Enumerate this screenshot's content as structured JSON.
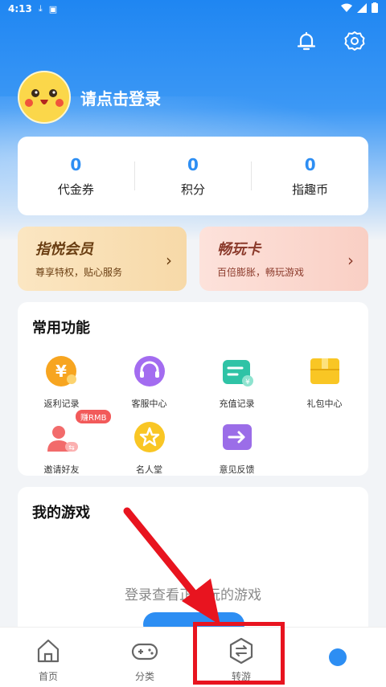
{
  "status_bar": {
    "time": "4:13"
  },
  "header": {
    "login_prompt": "请点击登录"
  },
  "stats": [
    {
      "value": "0",
      "label": "代金券"
    },
    {
      "value": "0",
      "label": "积分"
    },
    {
      "value": "0",
      "label": "指趣币"
    }
  ],
  "promos": [
    {
      "title": "指悦会员",
      "subtitle": "尊享特权，贴心服务"
    },
    {
      "title": "畅玩卡",
      "subtitle": "百倍膨胀，畅玩游戏"
    }
  ],
  "functions": {
    "title": "常用功能",
    "items": [
      {
        "label": "返利记录",
        "icon": "rebate-icon"
      },
      {
        "label": "客服中心",
        "icon": "headset-icon"
      },
      {
        "label": "充值记录",
        "icon": "recharge-icon"
      },
      {
        "label": "礼包中心",
        "icon": "gift-icon"
      },
      {
        "label": "邀请好友",
        "icon": "invite-icon",
        "badge": "赚RMB"
      },
      {
        "label": "名人堂",
        "icon": "star-icon"
      },
      {
        "label": "意见反馈",
        "icon": "feedback-icon"
      }
    ]
  },
  "my_games": {
    "title": "我的游戏",
    "empty_text": "登录查看正在玩的游戏"
  },
  "bottom_nav": [
    {
      "label": "首页",
      "icon": "home-icon"
    },
    {
      "label": "分类",
      "icon": "gamepad-icon"
    },
    {
      "label": "转游",
      "icon": "transfer-icon"
    }
  ],
  "colors": {
    "accent": "#2d8ef3",
    "highlight": "#e8141f"
  }
}
